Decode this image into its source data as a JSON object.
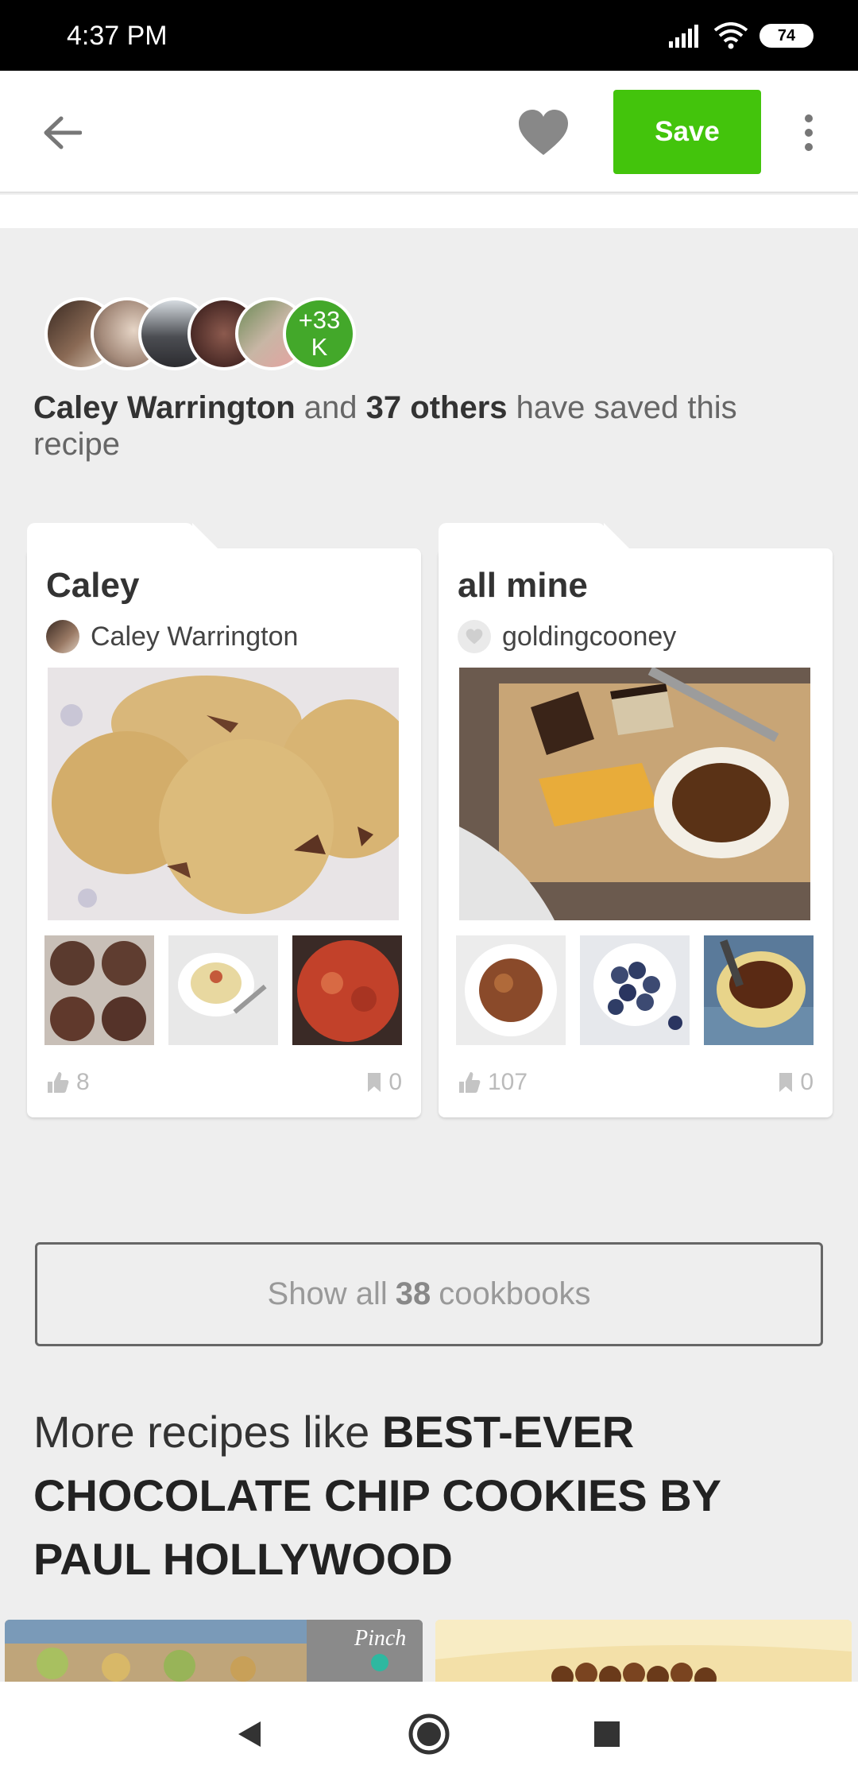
{
  "status_bar": {
    "time": "4:37 PM",
    "battery": "74"
  },
  "toolbar": {
    "save_label": "Save"
  },
  "savers": {
    "count_badge_line1": "+33",
    "count_badge_line2": "K",
    "primary_name": "Caley Warrington",
    "connector": "and",
    "others": "37 others",
    "suffix": "have saved this recipe"
  },
  "cookbooks": [
    {
      "title": "Caley",
      "owner": "Caley Warrington",
      "likes": "8",
      "saves": "0"
    },
    {
      "title": "all mine",
      "owner": "goldingcooney",
      "likes": "107",
      "saves": "0"
    }
  ],
  "show_all": {
    "prefix": "Show all",
    "count": "38",
    "suffix": "cookbooks"
  },
  "more_recipes": {
    "prefix": "More recipes like",
    "recipe_name": "BEST-EVER CHOCOLATE CHIP COOKIES BY PAUL HOLLYWOOD"
  },
  "recipe_card_watermark": "Pinch",
  "colors": {
    "accent": "#43c40c",
    "badge": "#43a82a"
  }
}
